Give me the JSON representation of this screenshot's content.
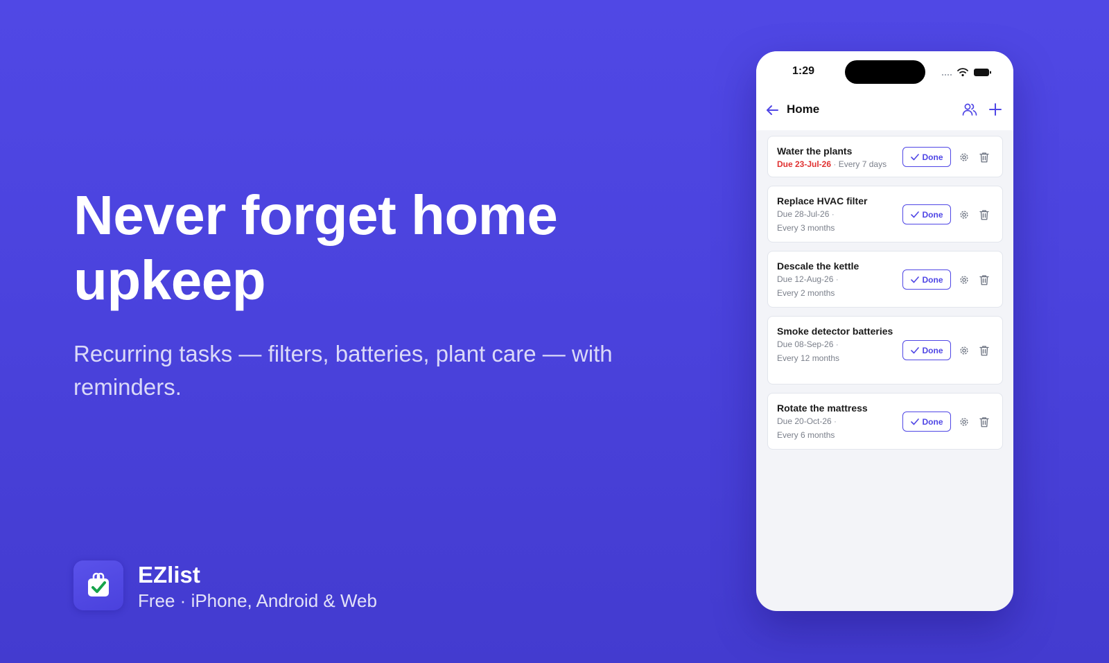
{
  "hero": {
    "title": "Never forget home upkeep",
    "subtitle": "Recurring tasks — filters, batteries, plant care — with reminders."
  },
  "brand": {
    "name": "EZlist",
    "tagline": "Free · iPhone, Android & Web",
    "icon": "checklist-bag-icon"
  },
  "phone": {
    "status_time": "1:29",
    "screen_title": "Home",
    "done_label": "Done",
    "colors": {
      "accent": "#4f46e5",
      "overdue": "#e03131",
      "background": "#5048e5"
    },
    "tasks": [
      {
        "name": "Water the plants",
        "due": "Due 23-Jul-26",
        "frequency": "Every 7 days",
        "overdue": true
      },
      {
        "name": "Replace HVAC filter",
        "due": "Due 28-Jul-26",
        "frequency": "Every 3 months",
        "overdue": false
      },
      {
        "name": "Descale the kettle",
        "due": "Due 12-Aug-26",
        "frequency": "Every 2 months",
        "overdue": false
      },
      {
        "name": "Smoke detector batteries",
        "due": "Due 08-Sep-26",
        "frequency": "Every 12 months",
        "overdue": false
      },
      {
        "name": "Rotate the mattress",
        "due": "Due 20-Oct-26",
        "frequency": "Every 6 months",
        "overdue": false
      }
    ]
  }
}
